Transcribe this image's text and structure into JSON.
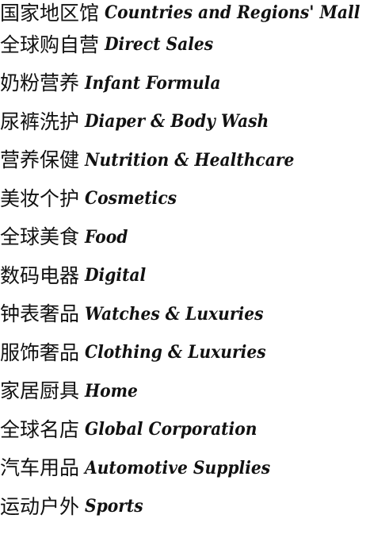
{
  "menu": {
    "items": [
      {
        "cn": "国家地区馆",
        "en": "Countries and Regions' Mall"
      },
      {
        "cn": "全球购自营",
        "en": "Direct Sales"
      },
      {
        "cn": "奶粉营养",
        "en": "Infant Formula"
      },
      {
        "cn": "尿裤洗护",
        "en": "Diaper & Body Wash"
      },
      {
        "cn": "营养保健",
        "en": "Nutrition & Healthcare"
      },
      {
        "cn": "美妆个护",
        "en": "Cosmetics"
      },
      {
        "cn": "全球美食",
        "en": "Food"
      },
      {
        "cn": "数码电器",
        "en": "Digital"
      },
      {
        "cn": "钟表奢品",
        "en": "Watches & Luxuries"
      },
      {
        "cn": "服饰奢品",
        "en": "Clothing & Luxuries"
      },
      {
        "cn": "家居厨具",
        "en": "Home"
      },
      {
        "cn": "全球名店",
        "en": "Global Corporation"
      },
      {
        "cn": "汽车用品",
        "en": "Automotive Supplies"
      },
      {
        "cn": "运动户外",
        "en": "Sports"
      }
    ]
  }
}
